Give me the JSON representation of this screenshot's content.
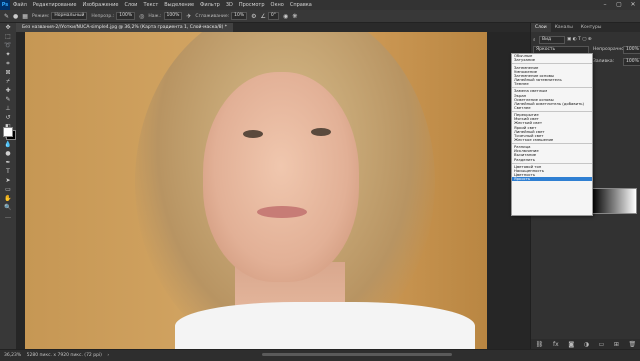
{
  "menubar": {
    "logo": "Ps",
    "items": [
      "Файл",
      "Редактирование",
      "Изображение",
      "Слои",
      "Текст",
      "Выделение",
      "Фильтр",
      "3D",
      "Просмотр",
      "Окно",
      "Справка"
    ]
  },
  "options": {
    "mode_label": "Режим:",
    "mode_value": "Нормальный",
    "opacity_label": "Непрозр.:",
    "opacity_value": "100%",
    "flow_label": "Наж.:",
    "flow_value": "100%",
    "smoothing_label": "Сглаживание:",
    "smoothing_value": "10%",
    "angle_value": "0°"
  },
  "document": {
    "tab_title": "Без названия-2//Уотки/NUCA-simple4.jpg @ 36,2% (Карта градиента 1, Слой-маска/8) *"
  },
  "status": {
    "zoom": "36,23%",
    "doc_info": "5280 пикс. x 7920 пикс. (72 ppi)"
  },
  "panels": {
    "tabs": [
      "Слои",
      "Каналы",
      "Контуры"
    ],
    "active_tab": "Слои",
    "kind_label": "Вид",
    "blend_label": "Яркость",
    "opacity_label": "Непрозрачность:",
    "opacity_value": "100%",
    "fill_label": "Заливка:",
    "fill_value": "100%"
  },
  "blend_dropdown": {
    "selected": "Яркость",
    "groups": [
      [
        "Обычные",
        "Затухание"
      ],
      [
        "Затемнение",
        "Умножение",
        "Затемнение основы",
        "Линейный затемнитель",
        "Темнее"
      ],
      [
        "Замена светлым",
        "Экран",
        "Осветление основы",
        "Линейный осветлитель (добавить)",
        "Светлее"
      ],
      [
        "Перекрытие",
        "Мягкий свет",
        "Жесткий свет",
        "Яркий свет",
        "Линейный свет",
        "Точечный свет",
        "Жесткое смешение"
      ],
      [
        "Разница",
        "Исключение",
        "Вычитание",
        "Разделить"
      ],
      [
        "Цветовой тон",
        "Насыщенность",
        "Цветность",
        "Яркость"
      ]
    ]
  },
  "icons": {
    "tools": [
      "move-icon",
      "marquee-icon",
      "lasso-icon",
      "quick-select-icon",
      "crop-icon",
      "frame-icon",
      "eyedropper-icon",
      "healing-icon",
      "brush-icon",
      "stamp-icon",
      "history-brush-icon",
      "eraser-icon",
      "gradient-icon",
      "blur-icon",
      "dodge-icon",
      "pen-icon",
      "type-icon",
      "path-select-icon",
      "rectangle-icon",
      "hand-icon",
      "zoom-icon"
    ]
  },
  "colors": {
    "accent": "#2f7fd2",
    "app_bg": "#262626",
    "panel_bg": "#323232"
  }
}
